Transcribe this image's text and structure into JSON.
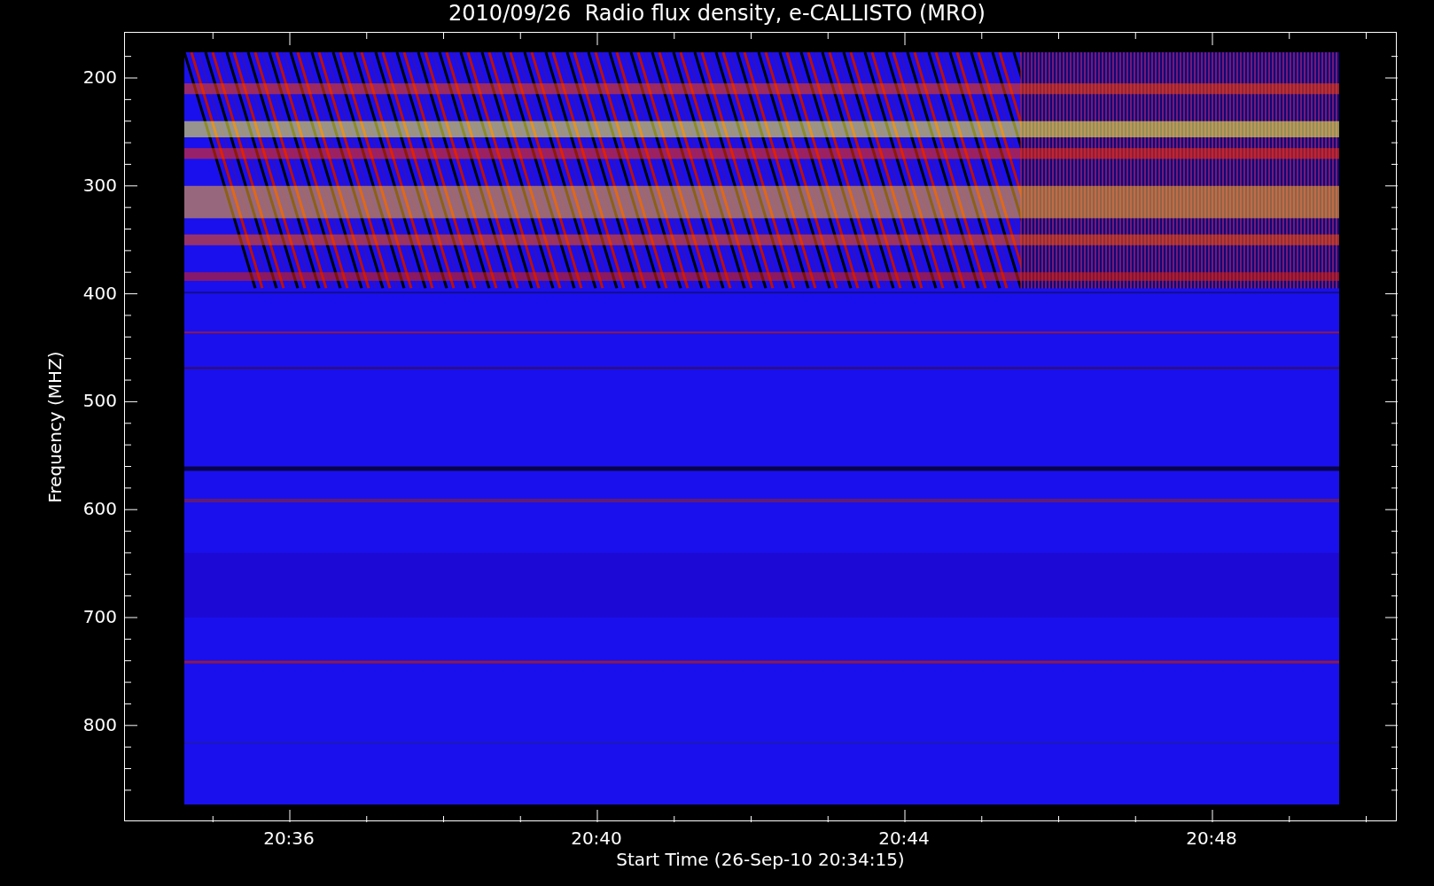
{
  "title": "2010/09/26  Radio flux density, e-CALLISTO (MRO)",
  "y_axis": {
    "title": "Frequency (MHZ)",
    "tick_labels": [
      "200",
      "300",
      "400",
      "500",
      "600",
      "700",
      "800"
    ]
  },
  "x_axis": {
    "title": "Start Time (26-Sep-10 20:34:15)",
    "tick_labels": [
      "20:36",
      "20:40",
      "20:44",
      "20:48"
    ]
  }
}
